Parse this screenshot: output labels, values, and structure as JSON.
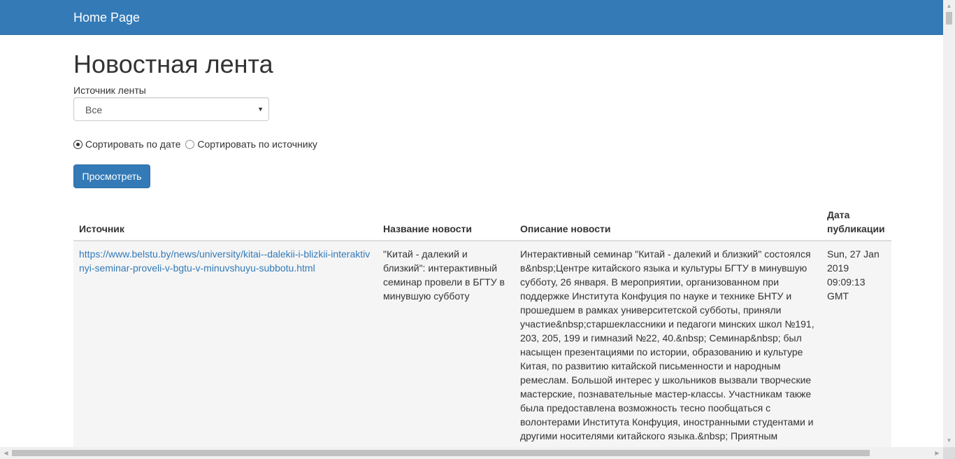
{
  "navbar": {
    "brand": "Home Page"
  },
  "page": {
    "title": "Новостная лента"
  },
  "filter": {
    "source_label": "Источник ленты",
    "source_selected": "Все"
  },
  "sort": {
    "by_date_label": "Сортировать по дате",
    "by_source_label": "Сортировать по источнику",
    "selected": "date"
  },
  "actions": {
    "view_button": "Просмотреть"
  },
  "table": {
    "columns": {
      "source": "Источник",
      "title": "Название новости",
      "description": "Описание новости",
      "date": "Дата публикации"
    },
    "rows": [
      {
        "source": "https://www.belstu.by/news/university/kitai--dalekii-i-blizkii-interaktivnyi-seminar-proveli-v-bgtu-v-minuvshuyu-subbotu.html",
        "title": "\"Китай - далекий и близкий\": интерактивный семинар провели в БГТУ в минувшую субботу",
        "description": "Интерактивный семинар \"Китай - далекий и близкий\" состоялся в&nbsp;Центре китайского языка и культуры БГТУ в минувшую субботу, 26 января. В мероприятии, организованном при поддержке Института Конфуция по науке и технике БНТУ и прошедшем в рамках университетской субботы, приняли участие&nbsp;старшеклассники и педагоги минских школ №191, 203, 205, 199 и гимназий №22, 40.&nbsp; Семинар&nbsp; был насыщен презентациями по истории, образованию и культуре Китая, по развитию китайской письменности и народным ремеслам. Большой интерес у школьников вызвали творческие мастерские, познавательные мастер-классы. Участникам также была предоставлена возможность тесно пообщаться с волонтерами Института Конфуция, иностранными студентами и другими носителями китайского языка.&nbsp; Приятным",
        "date": "Sun, 27 Jan 2019 09:09:13 GMT"
      }
    ]
  },
  "icons": {
    "select_caret": "▼",
    "scroll_up": "▲",
    "scroll_down": "▼",
    "scroll_left": "◀",
    "scroll_right": "▶"
  },
  "colors": {
    "primary": "#337ab7",
    "link": "#337ab7",
    "row_background": "#f5f5f5"
  }
}
